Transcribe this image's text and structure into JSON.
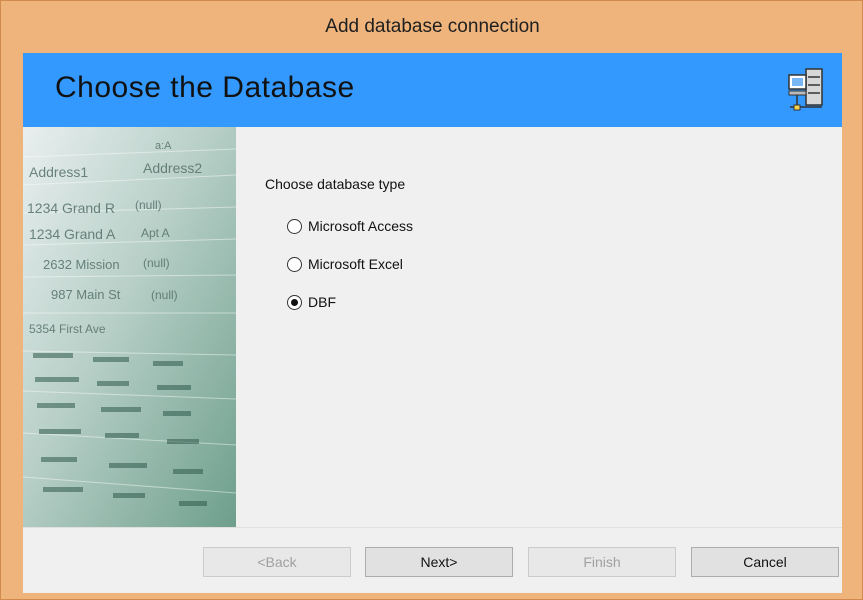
{
  "window": {
    "title": "Add database connection"
  },
  "banner": {
    "title": "Choose the Database",
    "icon": "network-database-icon"
  },
  "content": {
    "group_label": "Choose database type",
    "options": [
      {
        "label": "Microsoft Access",
        "selected": false
      },
      {
        "label": "Microsoft Excel",
        "selected": false
      },
      {
        "label": "DBF",
        "selected": true
      }
    ]
  },
  "side_image": {
    "texts": [
      "Address1",
      "Address2",
      "a:A",
      "1234 Grand R",
      "(null)",
      "1234 Grand A",
      "Apt A",
      "2632 Mission",
      "(null)",
      "987 Main St",
      "(null)",
      "5354 First Ave"
    ]
  },
  "buttons": {
    "back": "<Back",
    "next": "Next>",
    "finish": "Finish",
    "cancel": "Cancel"
  },
  "colors": {
    "window_frame": "#efb47c",
    "banner": "#3399ff",
    "client_bg": "#f0f0f0"
  }
}
